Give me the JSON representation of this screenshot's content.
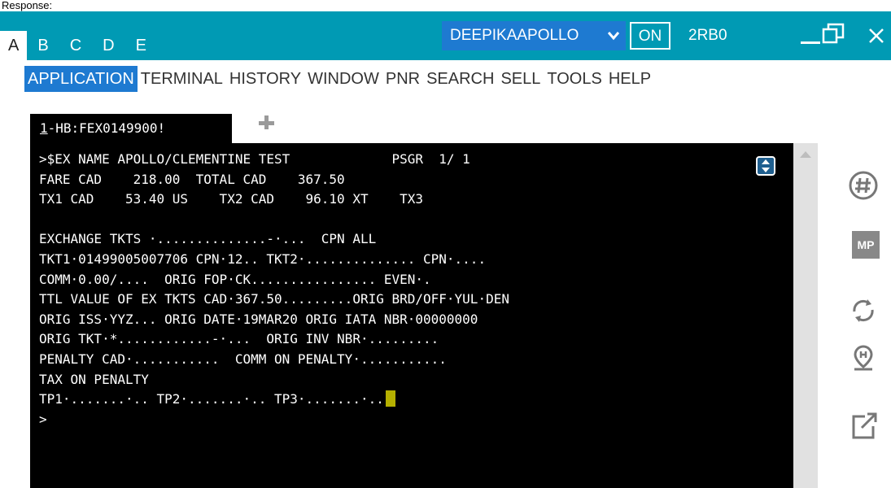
{
  "caption": "Response:",
  "titlebar": {
    "workspace_tabs": [
      "A",
      "B",
      "C",
      "D",
      "E"
    ],
    "user": "DEEPIKAAPOLLO",
    "on_label": "ON",
    "pcc": "2RB0",
    "bg_color": "#009ab4"
  },
  "menu": [
    "APPLICATION",
    "TERMINAL",
    "HISTORY",
    "WINDOW",
    "PNR",
    "SEARCH",
    "SELL",
    "TOOLS",
    "HELP"
  ],
  "terminal_tab": {
    "number": "1",
    "label": "-HB:FEX0149900!"
  },
  "terminal": {
    "lines": [
      ">$EX NAME APOLLO/CLEMENTINE TEST             PSGR  1/ 1",
      "FARE CAD    218.00  TOTAL CAD    367.50",
      "TX1 CAD    53.40 US    TX2 CAD    96.10 XT    TX3",
      "",
      "EXCHANGE TKTS ·..............-·...  CPN ALL",
      "TKT1·01499005007706 CPN·12.. TKT2·.............. CPN·....",
      "COMM·0.00/....  ORIG FOP·CK................ EVEN·.",
      "TTL VALUE OF EX TKTS CAD·367.50.........ORIG BRD/OFF·YUL·DEN",
      "ORIG ISS·YYZ... ORIG DATE·19MAR20 ORIG IATA NBR·00000000",
      "ORIG TKT·*............-·...  ORIG INV NBR·.........",
      "PENALTY CAD·...........  COMM ON PENALTY·...........",
      "TAX ON PENALTY",
      "TP1·.......·.. TP2·.......·.. TP3·.......·..",
      ">"
    ],
    "cursor_color": "#b5b000"
  },
  "side_tools": {
    "mp_label": "MP"
  }
}
